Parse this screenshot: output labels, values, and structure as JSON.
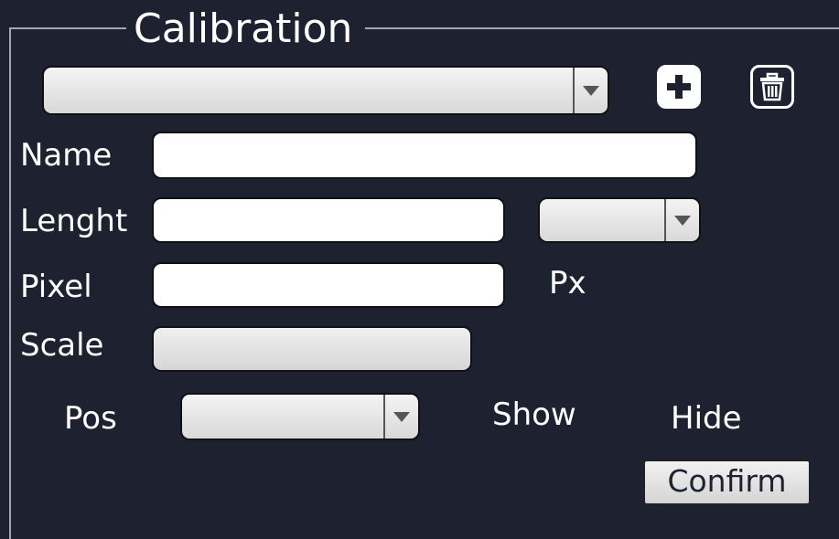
{
  "panel": {
    "title": "Calibration"
  },
  "calibration_select": {
    "value": ""
  },
  "name": {
    "label": "Name",
    "value": ""
  },
  "length": {
    "label": "Lenght",
    "value": "",
    "unit_value": ""
  },
  "pixel": {
    "label": "Pixel",
    "value": "",
    "unit": "Px"
  },
  "scale": {
    "label": "Scale",
    "value": ""
  },
  "pos": {
    "label": "Pos",
    "value": ""
  },
  "toggle": {
    "show": "Show",
    "hide": "Hide"
  },
  "confirm": {
    "label": "Confirm"
  },
  "icons": {
    "add": "plus-icon",
    "delete": "trash-icon"
  },
  "colors": {
    "background": "#1e2130",
    "border": "#a6a8b0"
  }
}
